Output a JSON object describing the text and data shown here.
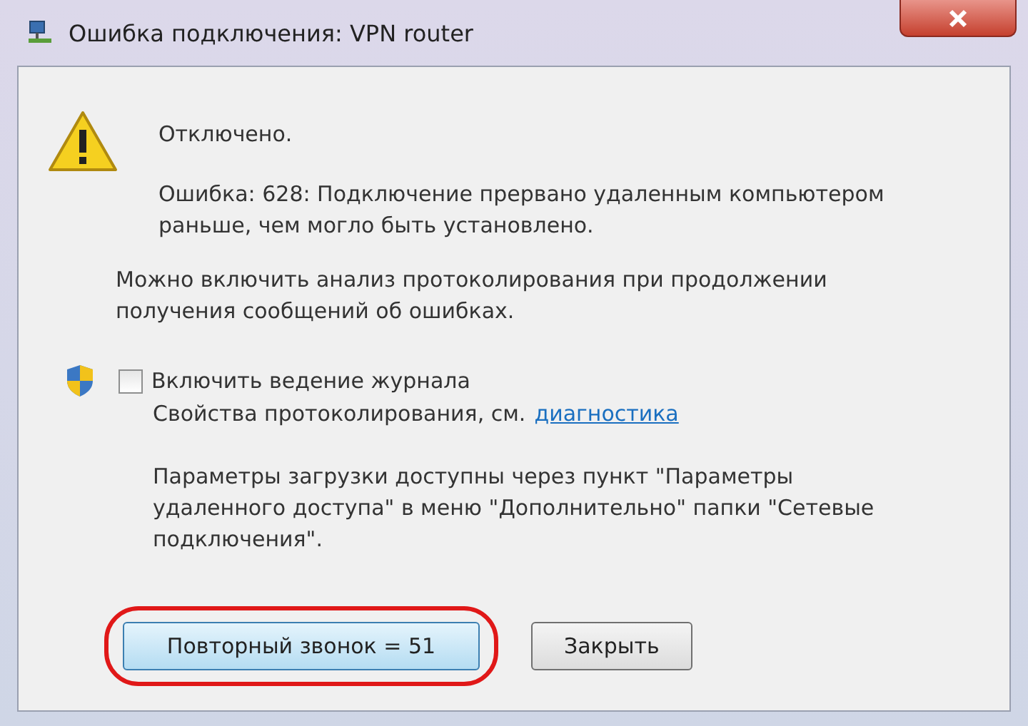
{
  "window": {
    "title": "Ошибка подключения: VPN router"
  },
  "status": "Отключено.",
  "error": "Ошибка: 628: Подключение прервано удаленным компьютером раньше, чем могло быть установлено.",
  "hint": "Можно включить анализ протоколирования при продолжении получения сообщений об ошибках.",
  "logging": {
    "label": "Включить ведение журнала",
    "checked": false
  },
  "properties": {
    "text": "Свойства протоколирования, см.",
    "link": "диагностика"
  },
  "note": "Параметры загрузки доступны через пункт \"Параметры удаленного доступа\" в меню \"Дополнительно\" папки \"Сетевые подключения\".",
  "buttons": [
    {
      "label": "Повторный звонок = 51",
      "default": true,
      "highlighted": true
    },
    {
      "label": "Закрыть",
      "default": false,
      "highlighted": false
    }
  ]
}
